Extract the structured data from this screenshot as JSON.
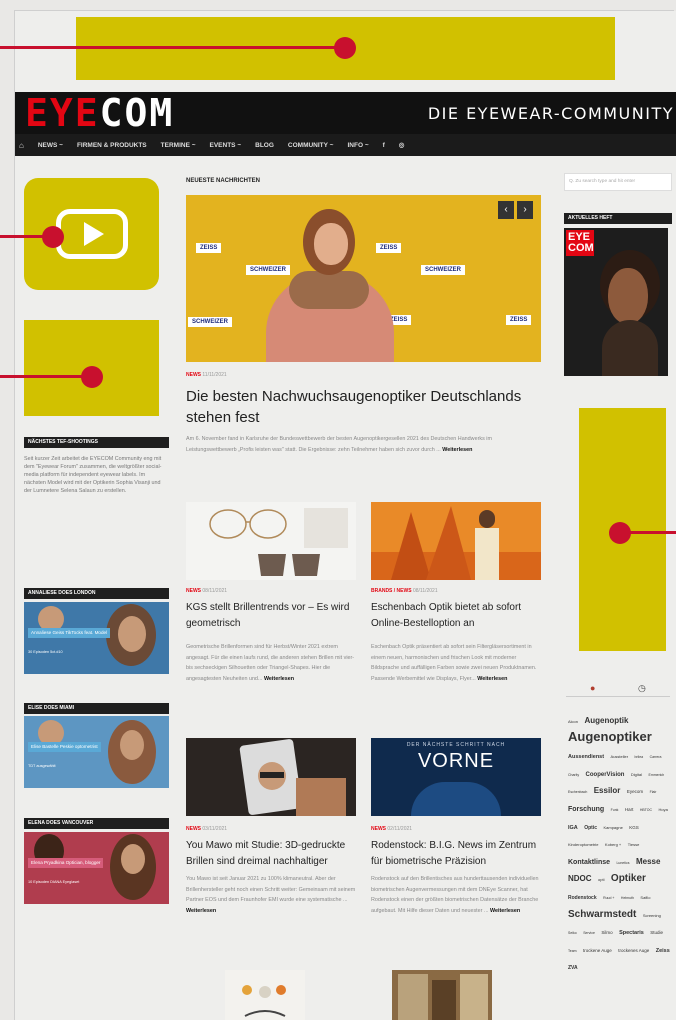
{
  "header": {
    "logo_a": "EYE",
    "logo_b": "COM",
    "tagline": "DIE EYEWEAR-COMMUNITY"
  },
  "nav": {
    "items": [
      "NEWS ~",
      "FIRMEN & PRODUKTS",
      "TERMINE ~",
      "EVENTS ~",
      "BLOG",
      "COMMUNITY ~",
      "INFO ~",
      "f",
      "◎"
    ]
  },
  "colors": {
    "callout": "#d1c100",
    "callout_accent": "#c8102e",
    "brand_red": "#e30613"
  },
  "left": {
    "shooting_head": "NÄCHSTES TEF-SHOOTINGS",
    "shooting_text": "Seit kurzer Zeit arbeitet die EYECOM Community eng mit dem \"Eyewear Forum\" zusammen, die weltgrößter social-media platform für independent eyewear labels. Im nächsten Model wird mit der Optikerin Sophia Visanji und der Lumnetere Selena Salaun zu erstellen.",
    "london_head": "ANNALIESE DOES LONDON",
    "london_tag": "Annaliese Geiss TikTocks feat. Model",
    "london_small": "30 Episoden 5ct.d10",
    "miami_head": "ELISE DOES MIAMI",
    "miami_tag": "Elise Bastelle Peskie optometrist",
    "miami_small": "TDT ausgewählt",
    "vancouver_head": "ELENA DOES VANCOUVER",
    "vancouver_tag": "Elena Pryadkina Optician, blogger",
    "vancouver_small": "10 Episoden DIANA Eyeglaset"
  },
  "main": {
    "section_title": "NEUESTE NACHRICHTEN",
    "hero_wall": [
      "ZEISS",
      "SCHWEIZER",
      "ZEISS",
      "SCHWEIZER",
      "ZEISS",
      "SCHWEIZER",
      "ZEISS"
    ],
    "hero_arrow_left": "‹",
    "hero_arrow_right": "›",
    "hero_meta_cat": "NEWS",
    "hero_meta_date": "11/11/2021",
    "hero_headline": "Die besten Nachwuchsaugenoptiker Deutschlands stehen fest",
    "hero_excerpt": "Am 6. November fand in Karlsruhe der Bundeswettbewerb der besten Augenoptikergesellen 2021 des Deutschen Handwerks im Leistungswettbewerb „Profis leisten was\" statt. Die Ergebnisse: zehn Teilnehmer haben sich zuvor durch ...",
    "more": "Weiterlesen",
    "articles": [
      {
        "cat": "NEWS",
        "date": "08/11/2021",
        "title": "KGS stellt Brillentrends vor – Es wird geometrisch",
        "excerpt": "Geometrische Brillenformen sind für Herbst/Winter 2021 extrem angesagt. Für die einen laufs rund, die anderen stehen Brillen mit vier- bis sechseckigen Silhouetten oder Triangel-Shapes. Hier die angesagtesten Neuheiten und..."
      },
      {
        "cat": "BRANDS / NEWS",
        "date": "08/11/2021",
        "title": "Eschenbach Optik bietet ab sofort Online-Bestelloption an",
        "excerpt": "Eschenbach Optik präsentiert ab sofort sein Filtergläsersortiment in einem neuen, harmonischen und frischen Look mit moderner Bildsprache und auffälligen Farben sowie zwei neuen Produktnamen. Passende Werbemittel wie Displays, Flyer..."
      },
      {
        "cat": "NEWS",
        "date": "03/11/2021",
        "title": "You Mawo mit Studie: 3D-gedruckte Brillen sind dreimal nachhaltiger",
        "excerpt": "You Mawo ist seit Januar 2021 zu 100% klimaneutral. Aber der Brillenhersteller geht noch einen Schritt weiter: Gemeinsam mit seinem Partner EOS und dem Fraunhofer EMI wurde eine systematische ..."
      },
      {
        "cat": "NEWS",
        "date": "02/11/2021",
        "title": "Rodenstock: B.I.G. News im Zentrum für biometrische Präzision",
        "excerpt": "Rodenstock auf den Brillentisches aus hunderttausenden individuellen biometrischen Augenvermessungen mit dem DNEye Scanner, hat Rodenstock einen der größten biometrischen Datensätze der Branche aufgebaut. Mit Hilfe dieser Daten und neuester ..."
      }
    ],
    "vorne_small": "DER NÄCHSTE SCHRITT NACH",
    "vorne_big": "VORNE"
  },
  "right": {
    "search_placeholder": "Q. Zu search type and hit enter",
    "aktuelles": "AKTUELLES HEFT",
    "mag_logo_a": "EYE",
    "mag_logo_b": "COM",
    "tags": [
      {
        "t": "Alcon",
        "s": 4
      },
      {
        "t": "Augenoptik",
        "s": 8
      },
      {
        "t": "Augenoptiker",
        "s": 13
      },
      {
        "t": "Aussendienst",
        "s": 5.5
      },
      {
        "t": "Aussteller",
        "s": 4
      },
      {
        "t": "brilea",
        "s": 3.5
      },
      {
        "t": "Carrera",
        "s": 3.5
      },
      {
        "t": "Charity",
        "s": 3.5
      },
      {
        "t": "CooperVision",
        "s": 6
      },
      {
        "t": "Digital",
        "s": 4
      },
      {
        "t": "Emmerich",
        "s": 3.5
      },
      {
        "t": "Eschenbach",
        "s": 3.5
      },
      {
        "t": "Essilor",
        "s": 8
      },
      {
        "t": "Eyecom",
        "s": 4.5
      },
      {
        "t": "Flair",
        "s": 3.5
      },
      {
        "t": "Forschung",
        "s": 7
      },
      {
        "t": "Funk",
        "s": 3.5
      },
      {
        "t": "Hart",
        "s": 4.5
      },
      {
        "t": "HBTOC",
        "s": 3.5
      },
      {
        "t": "Hoya",
        "s": 4
      },
      {
        "t": "IGA",
        "s": 5.5
      },
      {
        "t": "Optic",
        "s": 5
      },
      {
        "t": "Kampagne",
        "s": 4
      },
      {
        "t": "KGS",
        "s": 4.5
      },
      {
        "t": "Kinderoptometrie",
        "s": 4
      },
      {
        "t": "Koberg +",
        "s": 4
      },
      {
        "t": "Tiesse",
        "s": 4
      },
      {
        "t": "Kontaktlinse",
        "s": 7
      },
      {
        "t": "Lunetics",
        "s": 3.5
      },
      {
        "t": "Messe",
        "s": 8
      },
      {
        "t": "NDOC",
        "s": 8
      },
      {
        "t": "opti",
        "s": 4
      },
      {
        "t": "Optiker",
        "s": 10
      },
      {
        "t": "Rodenstock",
        "s": 5
      },
      {
        "t": "Ruud +",
        "s": 3.5
      },
      {
        "t": "Helmuth",
        "s": 3.5
      },
      {
        "t": "Safilo",
        "s": 4
      },
      {
        "t": "Schwarmstedt",
        "s": 10
      },
      {
        "t": "Screening",
        "s": 4
      },
      {
        "t": "Seiko",
        "s": 3.5
      },
      {
        "t": "Service",
        "s": 3.5
      },
      {
        "t": "Silmo",
        "s": 4.5
      },
      {
        "t": "Spectaris",
        "s": 5.5
      },
      {
        "t": "Studie",
        "s": 4.5
      },
      {
        "t": "Team",
        "s": 3.5
      },
      {
        "t": "trockene Auge",
        "s": 4.5
      },
      {
        "t": "trockenes Auge",
        "s": 4.5
      },
      {
        "t": "Zeiss",
        "s": 5.5
      },
      {
        "t": "ZVA",
        "s": 5
      }
    ]
  }
}
